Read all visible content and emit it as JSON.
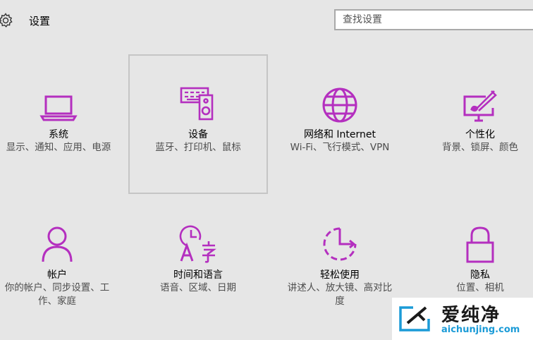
{
  "header": {
    "title": "设置",
    "icon": "gear-icon",
    "search_placeholder": "查找设置"
  },
  "accent_color": "#b42fbf",
  "tiles": [
    {
      "name": "系统",
      "desc": "显示、通知、应用、电源",
      "icon": "laptop-icon"
    },
    {
      "name": "设备",
      "desc": "蓝牙、打印机、鼠标",
      "icon": "keyboard-speaker-icon",
      "selected": true
    },
    {
      "name": "网络和 Internet",
      "desc": "Wi-Fi、飞行模式、VPN",
      "icon": "globe-icon"
    },
    {
      "name": "个性化",
      "desc": "背景、锁屏、颜色",
      "icon": "paint-monitor-icon"
    },
    {
      "name": "帐户",
      "desc": "你的帐户、同步设置、工作、家庭",
      "icon": "person-icon"
    },
    {
      "name": "时间和语言",
      "desc": "语音、区域、日期",
      "icon": "clock-language-icon"
    },
    {
      "name": "轻松使用",
      "desc": "讲述人、放大镜、高对比度",
      "icon": "ease-of-access-icon"
    },
    {
      "name": "隐私",
      "desc": "位置、相机",
      "icon": "lock-icon"
    }
  ],
  "watermark": {
    "title": "爱纯净",
    "url": "aichunjing.com"
  }
}
